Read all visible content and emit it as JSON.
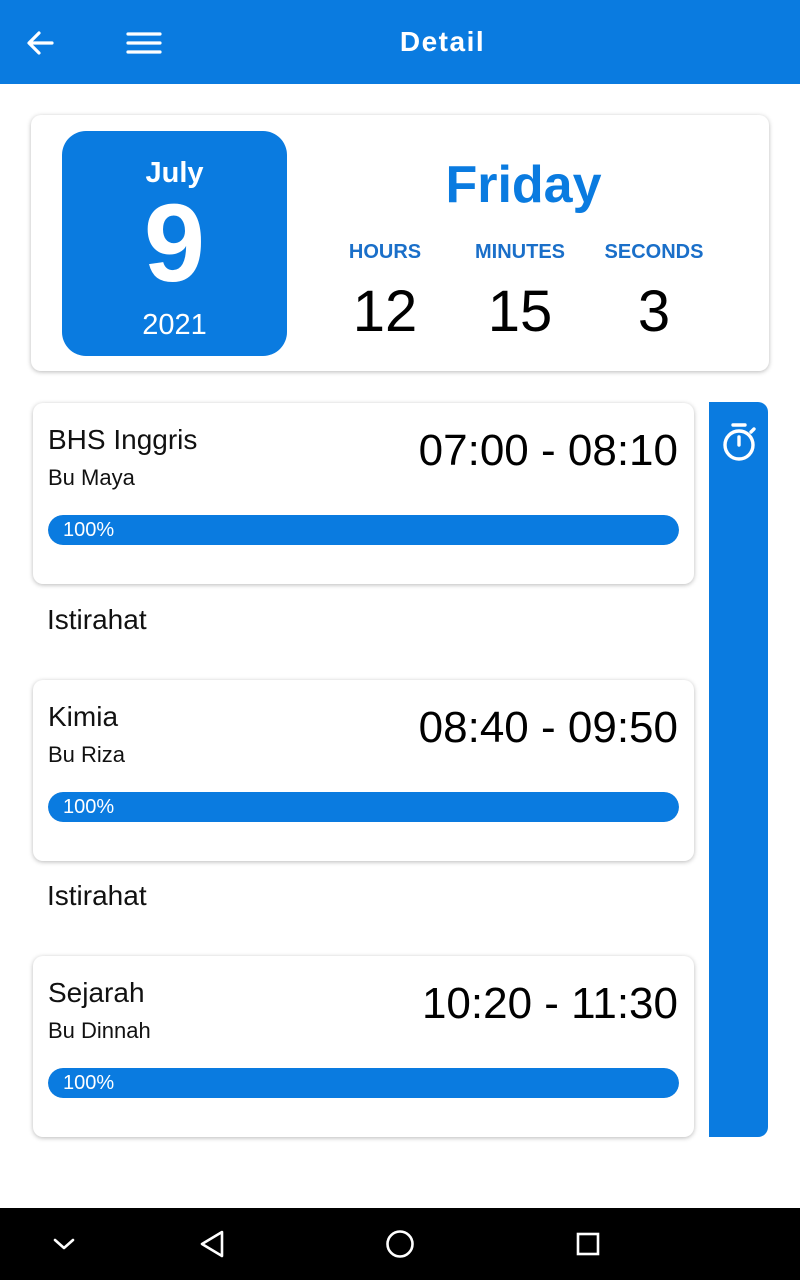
{
  "appbar": {
    "title": "Detail",
    "back_icon": "arrow-left-icon",
    "menu_icon": "hamburger-menu-icon"
  },
  "date": {
    "month": "July",
    "day": "9",
    "year": "2021",
    "weekday": "Friday"
  },
  "clock": {
    "hours_label": "HOURS",
    "hours": "12",
    "minutes_label": "MINUTES",
    "minutes": "15",
    "seconds_label": "SECONDS",
    "seconds": "3"
  },
  "schedule": [
    {
      "subject": "BHS Inggris",
      "teacher": "Bu Maya",
      "time": "07:00 - 08:10",
      "progress_label": "100%",
      "progress": 1.0
    },
    {
      "break_label": "Istirahat"
    },
    {
      "subject": "Kimia",
      "teacher": "Bu Riza",
      "time": "08:40 - 09:50",
      "progress_label": "100%",
      "progress": 1.0
    },
    {
      "break_label": "Istirahat"
    },
    {
      "subject": "Sejarah",
      "teacher": "Bu Dinnah",
      "time": "10:20 - 11:30",
      "progress_label": "100%",
      "progress": 1.0
    }
  ],
  "sidebar": {
    "icon": "stopwatch-icon"
  },
  "navbar": {
    "icons": [
      "chevron-down-icon",
      "back-triangle-icon",
      "home-circle-icon",
      "recents-square-icon"
    ]
  },
  "colors": {
    "primary": "#0a7be0",
    "bar_track": "#e0e0e0"
  }
}
